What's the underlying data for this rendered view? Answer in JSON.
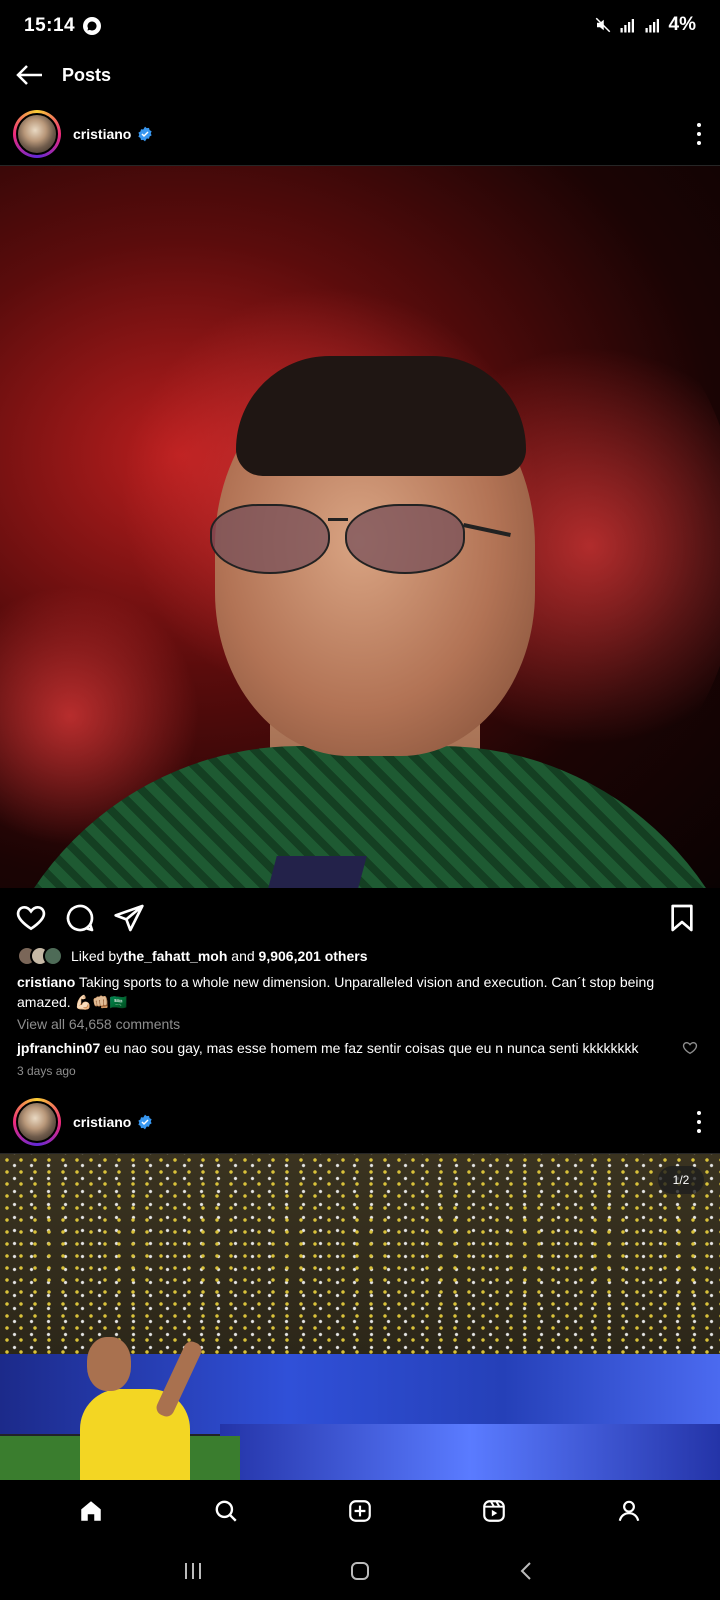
{
  "status_bar": {
    "time": "15:14",
    "battery": "4%"
  },
  "top_bar": {
    "title": "Posts"
  },
  "posts": [
    {
      "username": "cristiano",
      "liked_by_prefix": "Liked by ",
      "liked_by_user": "the_fahatt_moh",
      "liked_by_and": " and ",
      "liked_by_others": "9,906,201 others",
      "caption_user": "cristiano",
      "caption_text": "Taking sports to a whole new dimension. Unparalleled vision and execution. Can´t stop being amazed. 💪🏻👊🏼🇸🇦",
      "view_comments": "View all 64,658 comments",
      "comment_user": "jpfranchin07",
      "comment_text": "eu nao sou gay, mas esse homem me faz sentir coisas que eu n nunca senti kkkkkkkk",
      "timestamp": "3 days ago"
    },
    {
      "username": "cristiano",
      "carousel_indicator": "1/2"
    }
  ],
  "colors": {
    "verified": "#3897f0",
    "muted_text": "#8e8e8e",
    "background": "#000000"
  },
  "icons": [
    "whatsapp-icon",
    "mute-icon",
    "signal-icon",
    "back-arrow-icon",
    "verified-icon",
    "more-options-icon",
    "heart-icon",
    "comment-icon",
    "share-icon",
    "bookmark-icon",
    "home-icon",
    "search-icon",
    "create-icon",
    "reels-icon",
    "profile-icon",
    "recent-apps-icon",
    "home-circle-icon",
    "system-back-icon"
  ]
}
